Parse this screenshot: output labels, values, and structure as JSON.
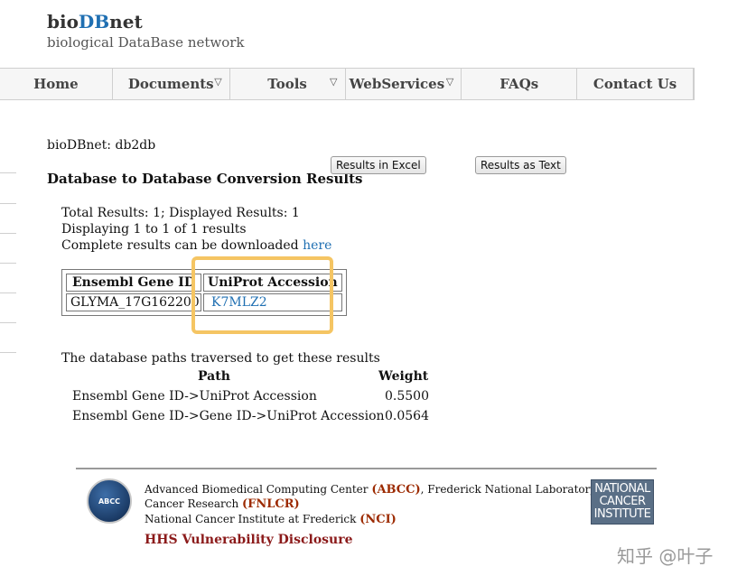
{
  "header": {
    "brand_prefix": "bio",
    "brand_db": "DB",
    "brand_suffix": "net",
    "subtitle": "biological DataBase network"
  },
  "nav": {
    "items": [
      {
        "label": "Home",
        "dropdown": false
      },
      {
        "label": "Documents",
        "dropdown": true
      },
      {
        "label": "Tools",
        "dropdown": true
      },
      {
        "label": "WebServices",
        "dropdown": true
      },
      {
        "label": "FAQs",
        "dropdown": false
      },
      {
        "label": "Contact Us",
        "dropdown": false
      }
    ],
    "chevron": "▽"
  },
  "page": {
    "breadcrumb": "bioDBnet: db2db",
    "title": "Database to Database Conversion Results",
    "buttons": {
      "excel": "Results in Excel",
      "text": "Results as Text"
    },
    "info": {
      "total": "Total Results: 1; Displayed Results: 1",
      "displaying": "Displaying 1 to 1 of 1 results",
      "download_prefix": "Complete results can be downloaded ",
      "download_link": "here"
    }
  },
  "results_table": {
    "headers": [
      "Ensembl Gene ID",
      "UniProt Accession"
    ],
    "rows": [
      [
        "GLYMA_17G162200",
        "K7MLZ2"
      ]
    ]
  },
  "paths": {
    "intro": "The database paths traversed to get these results",
    "headers": {
      "path": "Path",
      "weight": "Weight"
    },
    "rows": [
      {
        "path": "Ensembl Gene ID->UniProt Accession",
        "weight": "0.5500"
      },
      {
        "path": "Ensembl Gene ID->Gene ID->UniProt Accession",
        "weight": "0.0564"
      }
    ]
  },
  "footer": {
    "line1_prefix": "Advanced Biomedical Computing Center ",
    "line1_abbr": "(ABCC)",
    "line1_suffix": ", Frederick National Laboratory for",
    "line2_prefix": "Cancer Research ",
    "line2_abbr": "(FNLCR)",
    "line3_prefix": "National Cancer Institute at Frederick ",
    "line3_abbr": "(NCI)",
    "hhs": "HHS Vulnerability Disclosure",
    "abcc_logo_text": "ABCC",
    "nci_logo_lines": [
      "NATIONAL",
      "CANCER",
      "INSTITUTE"
    ]
  },
  "watermark": "知乎 @叶子",
  "colors": {
    "link": "#1f6fb2",
    "highlight": "#f5c563",
    "footer_accent": "#9c2a00"
  }
}
